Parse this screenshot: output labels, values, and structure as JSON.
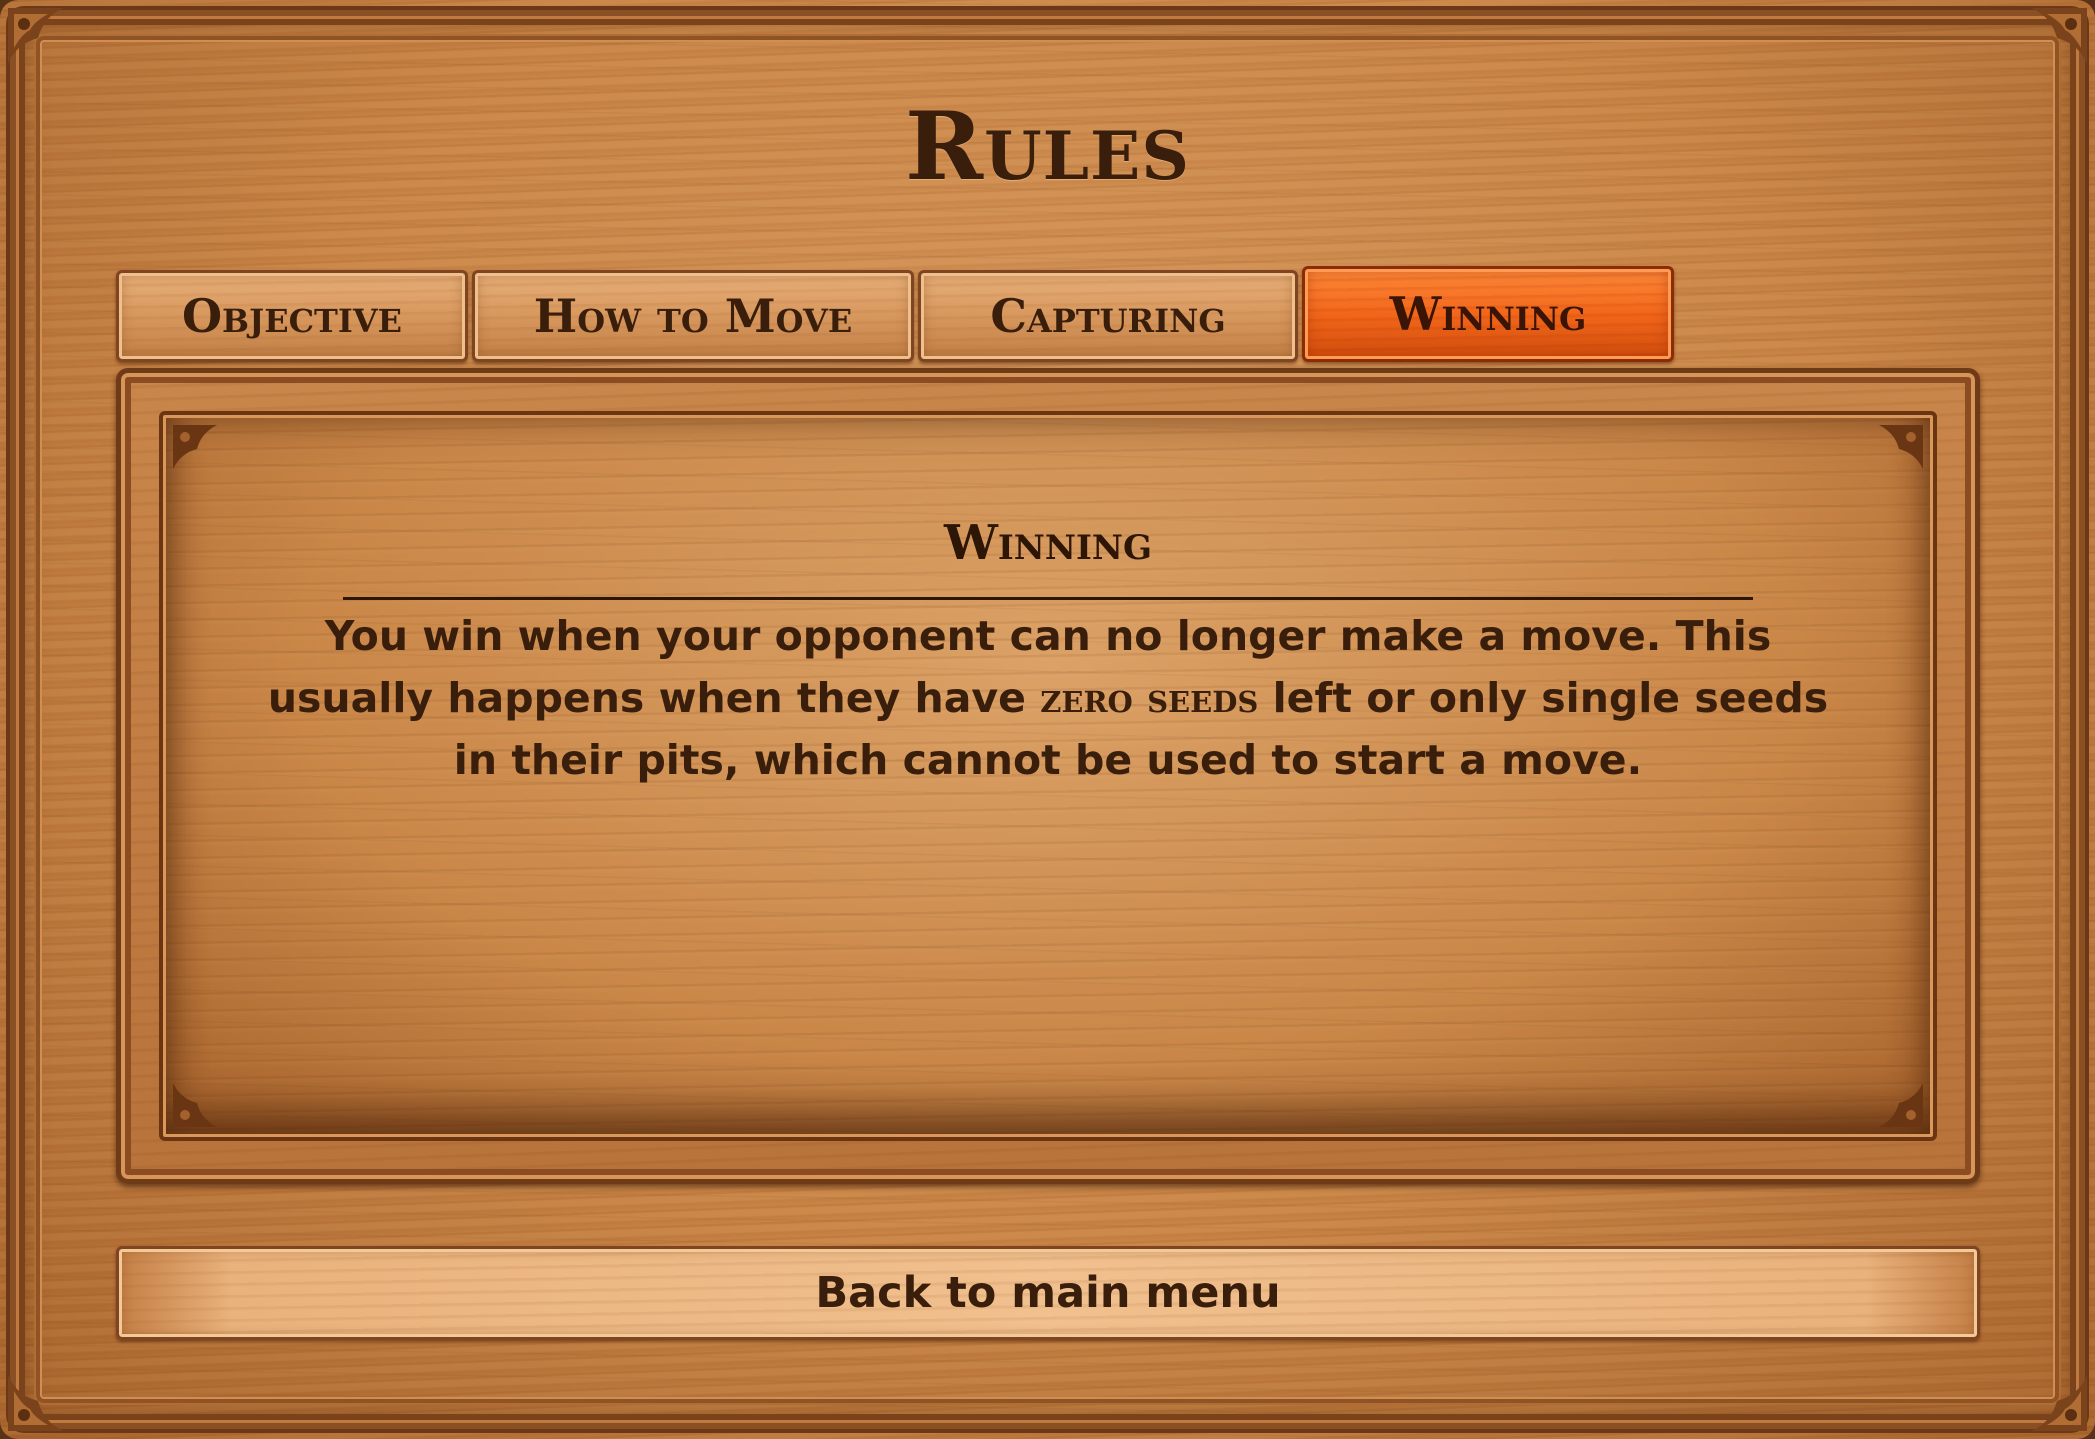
{
  "title": "Rules",
  "tabs": [
    {
      "label": "Objective",
      "active": false
    },
    {
      "label": "How to Move",
      "active": false
    },
    {
      "label": "Capturing",
      "active": false
    },
    {
      "label": "Winning",
      "active": true
    }
  ],
  "panel": {
    "heading": "Winning",
    "text_before": "You win when your opponent can no longer make a move. This usually happens when they have ",
    "emphasis": "zero seeds",
    "text_after": " left or only single seeds in their pits, which cannot be used to start a move."
  },
  "back_button": {
    "label": "Back to main menu"
  },
  "colors": {
    "wood": "#c98445",
    "wood_dark": "#6f3a16",
    "active_tab": "#f2661a",
    "text": "#3a1e0c"
  },
  "icons": {
    "frame_corner": "ornament-corner-icon"
  }
}
